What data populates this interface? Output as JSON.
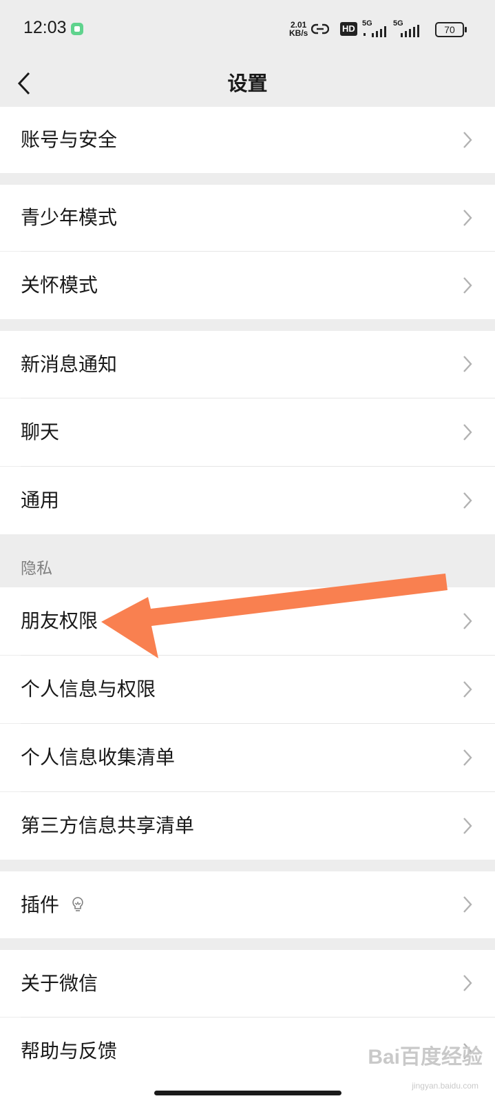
{
  "status_bar": {
    "time": "12:03",
    "net_speed_value": "2.01",
    "net_speed_unit": "KB/s",
    "hd_label": "HD",
    "sim1_label": "5G",
    "sim2_label": "5G",
    "battery": "70"
  },
  "nav": {
    "title": "设置"
  },
  "groups": [
    {
      "items": [
        {
          "label": "账号与安全"
        }
      ]
    },
    {
      "items": [
        {
          "label": "青少年模式"
        },
        {
          "label": "关怀模式"
        }
      ]
    },
    {
      "items": [
        {
          "label": "新消息通知"
        },
        {
          "label": "聊天"
        },
        {
          "label": "通用"
        }
      ]
    },
    {
      "header": "隐私",
      "items": [
        {
          "label": "朋友权限"
        },
        {
          "label": "个人信息与权限"
        },
        {
          "label": "个人信息收集清单"
        },
        {
          "label": "第三方信息共享清单"
        }
      ]
    },
    {
      "items": [
        {
          "label": "插件"
        }
      ]
    },
    {
      "items": [
        {
          "label": "关于微信"
        },
        {
          "label": "帮助与反馈"
        }
      ]
    }
  ],
  "annotation": {
    "color": "#f98050"
  },
  "watermark": {
    "brand": "Bai百度经验",
    "url": "jingyan.baidu.com"
  }
}
